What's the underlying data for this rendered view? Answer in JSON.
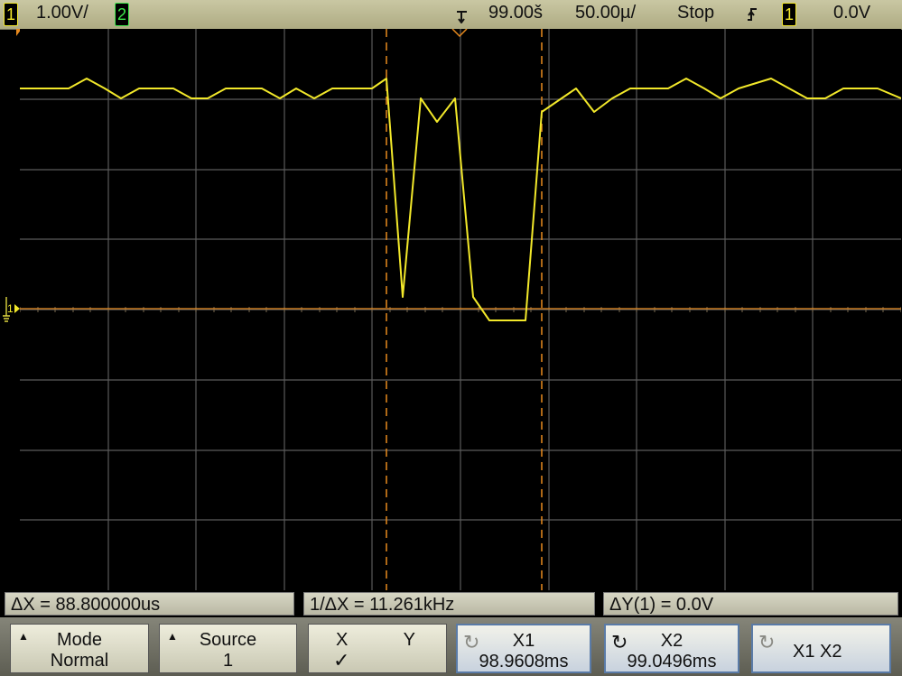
{
  "topbar": {
    "ch1_label": "1",
    "ch1_scale": "1.00V/",
    "ch2_label": "2",
    "delay": "99.00š",
    "timebase": "50.00µ/",
    "run_state": "Stop",
    "trigger_slope_icon": "rising-edge-icon",
    "trigger_source": "1",
    "trigger_level": "0.0V"
  },
  "measurements": {
    "delta_x": "ΔX = 88.800000us",
    "inv_delta_x": "1/ΔX = 11.261kHz",
    "delta_y": "ΔY(1) = 0.0V"
  },
  "softkeys": {
    "mode_title": "Mode",
    "mode_value": "Normal",
    "source_title": "Source",
    "source_value": "1",
    "x_label": "X",
    "y_label": "Y",
    "xy_check": "✓",
    "x1_title": "X1",
    "x1_value": "98.9608ms",
    "x2_title": "X2",
    "x2_value": "99.0496ms",
    "x1x2_label": "X1 X2"
  },
  "screen": {
    "ground_marker": "1",
    "trace_color": "#f2e82a",
    "cursor_color": "#e88a1e",
    "grid_color": "#5b5b5b"
  }
}
